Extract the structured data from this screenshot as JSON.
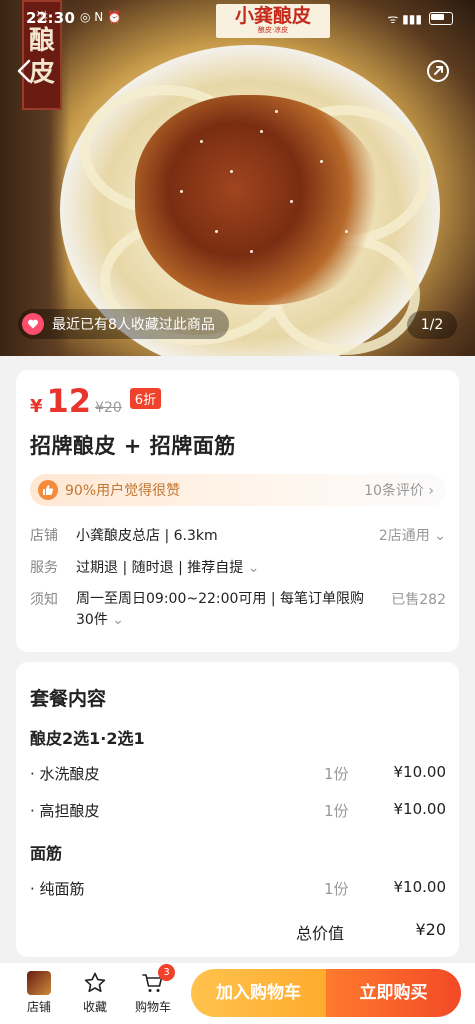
{
  "status_bar": {
    "time": "22:30",
    "left_icons": "◎ N ⏰",
    "signal": "ᯤ ▮▮▮"
  },
  "hero": {
    "brand_name": "小龚酿皮",
    "brand_sub": "酿皮·凉皮",
    "seal_small": "洪",
    "seal_chars": [
      "酿",
      "皮"
    ],
    "favorite_text": "最近已有8人收藏过此商品",
    "page_indicator": "1/2"
  },
  "product": {
    "currency": "¥",
    "price": "12",
    "original_price": "¥20",
    "discount": "6折",
    "title": "招牌酿皮 + 招牌面筋",
    "praise_text": "90%用户觉得很赞",
    "review_count": "10条评价"
  },
  "info": {
    "store_label": "店铺",
    "store_value": "小龚酿皮总店 | 6.3km",
    "store_right": "2店通用",
    "service_label": "服务",
    "service_value": "过期退 | 随时退 | 推荐自提",
    "notice_label": "须知",
    "notice_value_line1": "周一至周日09:00~22:00可用 | 每笔订单限购",
    "notice_value_line2": "30件",
    "sold": "已售282"
  },
  "package": {
    "title": "套餐内容",
    "groups": [
      {
        "name": "酿皮2选1·2选1",
        "items": [
          {
            "name": "水洗酿皮",
            "qty": "1份",
            "price": "¥10.00"
          },
          {
            "name": "高担酿皮",
            "qty": "1份",
            "price": "¥10.00"
          }
        ]
      },
      {
        "name": "面筋",
        "items": [
          {
            "name": "纯面筋",
            "qty": "1份",
            "price": "¥10.00"
          }
        ]
      }
    ],
    "total_label": "总价值",
    "total_value": "¥20"
  },
  "bottom_bar": {
    "store_label": "店铺",
    "favorite_label": "收藏",
    "cart_label": "购物车",
    "cart_count": "3",
    "add_cart_label": "加入购物车",
    "buy_now_label": "立即购买"
  },
  "colors": {
    "accent": "#e8342b",
    "add_cart": "#ffb83a",
    "buy_now": "#f5512a",
    "praise": "#c2762f"
  }
}
